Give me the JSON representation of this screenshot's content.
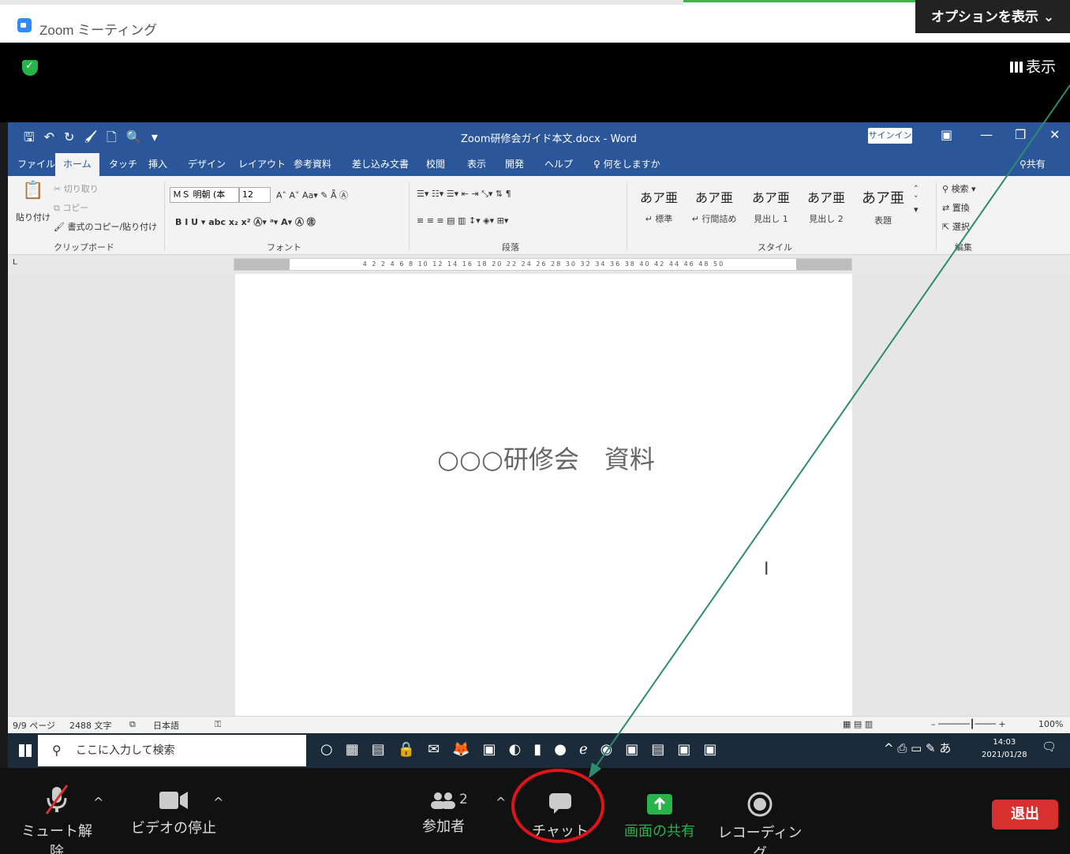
{
  "zoom": {
    "window_title": "Zoom ミーティング",
    "options_label": "オプションを表示 ⌄",
    "view_label": "表示"
  },
  "word": {
    "doc_title": "Zoom研修会ガイド本文.docx - Word",
    "signin_label": "サインイン",
    "tabs": [
      "ファイル",
      "ホーム",
      "タッチ",
      "挿入",
      "デザイン",
      "レイアウト",
      "参考資料",
      "差し込み文書",
      "校閲",
      "表示",
      "開発",
      "ヘルプ",
      "何をしますか"
    ],
    "share_label": "共有",
    "ribbon": {
      "clipboard": {
        "label": "クリップボード",
        "paste": "貼り付け",
        "cut": "切り取り",
        "copy": "コピー",
        "format_painter": "書式のコピー/貼り付け"
      },
      "font": {
        "label": "フォント",
        "font_name": "ＭＳ 明朝 (本",
        "font_size": "12"
      },
      "paragraph": {
        "label": "段落"
      },
      "styles": {
        "label": "スタイル",
        "items": [
          {
            "sample": "あア亜",
            "name": "↵ 標準"
          },
          {
            "sample": "あア亜",
            "name": "↵ 行間詰め"
          },
          {
            "sample": "あア亜",
            "name": "見出し 1"
          },
          {
            "sample": "あア亜",
            "name": "見出し 2"
          },
          {
            "sample": "あア亜",
            "name": "表題"
          }
        ]
      },
      "editing": {
        "label": "編集",
        "find": "検索",
        "replace": "置換",
        "select": "選択"
      }
    },
    "ruler_numbers": "4  2     2  4  6  8  10  12  14  16  18  20  22  24  26  28  30  32  34  36  38  40  42  44  46  48  50",
    "document_heading": "○○○研修会　資料",
    "status": {
      "page": "9/9 ページ",
      "words": "2488 文字",
      "language": "日本語",
      "zoom": "100%"
    }
  },
  "taskbar": {
    "search_placeholder": "ここに入力して検索",
    "time": "14:03",
    "date": "2021/01/28",
    "ime": "あ"
  },
  "zoom_controls": {
    "mute": "ミュート解除",
    "video": "ビデオの停止",
    "participants": "参加者",
    "participant_count": "2",
    "chat": "チャット",
    "share": "画面の共有",
    "record": "レコーディング",
    "end": "退出"
  },
  "colors": {
    "word_blue": "#2b579a",
    "zoom_share_green": "#27b24a",
    "zoom_end_red": "#d8302f",
    "annotation_red": "#e0121a",
    "annotation_arrow": "#2e8b6e"
  }
}
